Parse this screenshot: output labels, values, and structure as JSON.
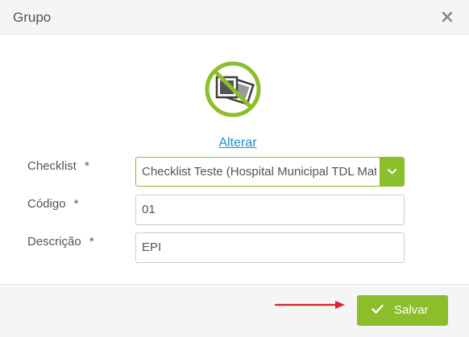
{
  "modal": {
    "title": "Grupo",
    "change_image_link": "Alterar"
  },
  "form": {
    "checklist": {
      "label": "Checklist",
      "required_mark": "*",
      "selected": "Checklist Teste (Hospital Municipal TDL Mat"
    },
    "codigo": {
      "label": "Código",
      "required_mark": "*",
      "value": "01"
    },
    "descricao": {
      "label": "Descrição",
      "required_mark": "*",
      "value": "EPI"
    }
  },
  "footer": {
    "save_label": "Salvar"
  },
  "icons": {
    "close": "close-icon",
    "no_image": "no-image-icon",
    "dropdown": "chevron-down-icon",
    "save": "check-icon",
    "annotation": "red-arrow-icon"
  },
  "colors": {
    "accent": "#8cbd2a",
    "link": "#1a8fc9",
    "annotation_arrow": "#d9262a"
  }
}
